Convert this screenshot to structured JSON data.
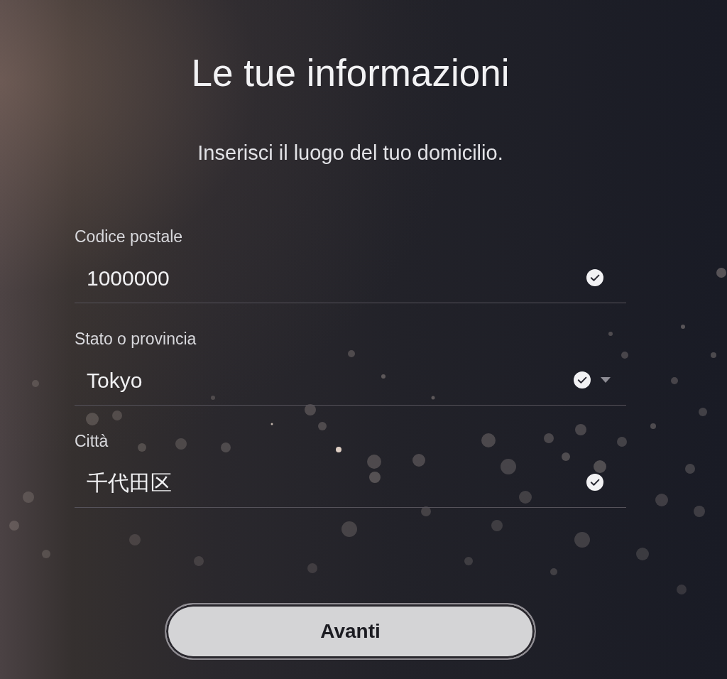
{
  "title": "Le tue informazioni",
  "subtitle": "Inserisci il luogo del tuo domicilio.",
  "fields": [
    {
      "label": "Codice postale",
      "value": "1000000",
      "kind": "text",
      "valid": true
    },
    {
      "label": "Stato o provincia",
      "value": "Tokyo",
      "kind": "dropdown",
      "valid": true
    },
    {
      "label": "Città",
      "value": "千代田区",
      "kind": "text",
      "valid": true
    }
  ],
  "button": {
    "label": "Avanti"
  }
}
